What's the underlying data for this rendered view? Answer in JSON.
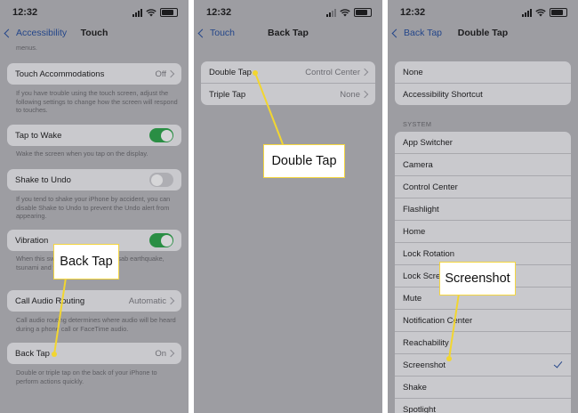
{
  "status_bar": {
    "time": "12:32"
  },
  "panels": {
    "touch": {
      "back_label": "Accessibility",
      "title": "Touch",
      "top_fragment": "menus.",
      "touch_accommodations": {
        "label": "Touch Accommodations",
        "value": "Off"
      },
      "touch_accommodations_note": "If you have trouble using the touch screen, adjust the following settings to change how the screen will respond to touches.",
      "tap_to_wake": {
        "label": "Tap to Wake",
        "on": true
      },
      "tap_to_wake_note": "Wake the screen when you tap on the display.",
      "shake_to_undo": {
        "label": "Shake to Undo",
        "on": false
      },
      "shake_to_undo_note": "If you tend to shake your iPhone by accident, you can disable Shake to Undo to prevent the Undo alert from appearing.",
      "vibration": {
        "label": "Vibration",
        "on": true
      },
      "vibration_note": "When this sw                     your iPhone will be disab                   earthquake, tsunami and                  warnings.",
      "call_audio_routing": {
        "label": "Call Audio Routing",
        "value": "Automatic"
      },
      "call_audio_routing_note": "Call audio routing determines where audio will be heard during a phone call or FaceTime audio.",
      "back_tap": {
        "label": "Back Tap",
        "value": "On"
      },
      "back_tap_note": "Double or triple tap on the back of your iPhone to perform actions quickly.",
      "callout": "Back Tap"
    },
    "back_tap": {
      "back_label": "Touch",
      "title": "Back Tap",
      "rows": [
        {
          "label": "Double Tap",
          "value": "Control Center"
        },
        {
          "label": "Triple Tap",
          "value": "None"
        }
      ],
      "callout": "Double Tap"
    },
    "double_tap": {
      "back_label": "Back Tap",
      "title": "Double Tap",
      "top_rows": [
        "None",
        "Accessibility Shortcut"
      ],
      "section_header": "SYSTEM",
      "system_rows": [
        "App Switcher",
        "Camera",
        "Control Center",
        "Flashlight",
        "Home",
        "Lock Rotation",
        "Lock Scre",
        "Mute",
        "Notification Center",
        "Reachability",
        "Screenshot",
        "Shake",
        "Spotlight"
      ],
      "selected": "Screenshot",
      "callout": "Screenshot"
    }
  },
  "colors": {
    "panel_bg": "#9d9da2",
    "cell_bg": "#c9c9cd",
    "link": "#24468a",
    "toggle_on": "#2a8e44",
    "callout_border": "#f4d640",
    "leader": "#f2d630"
  }
}
